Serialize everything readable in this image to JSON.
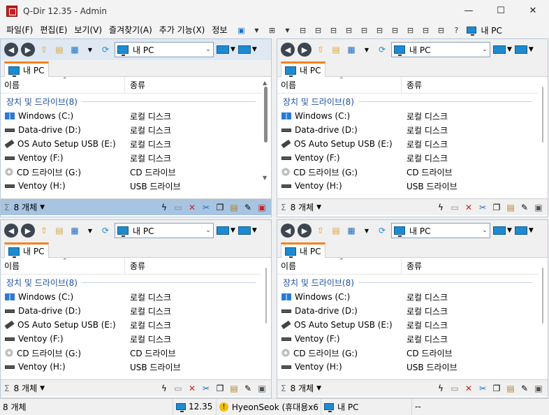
{
  "window": {
    "title": "Q-Dir 12.35 - Admin",
    "minimize": "—",
    "maximize": "☐",
    "close": "✕"
  },
  "menu": [
    "파일(F)",
    "편집(E)",
    "보기(V)",
    "즐겨찾기(A)",
    "추가 기능(X)",
    "정보"
  ],
  "menu_right_label": "내 PC",
  "panes": [
    {
      "address": "내 PC",
      "tab": "내 PC",
      "columns": {
        "name": "이름",
        "type": "종류"
      },
      "group": "장치 및 드라이브(8)",
      "rows": [
        {
          "name": "Windows (C:)",
          "type": "로컬 디스크",
          "icon": "windows-drive-icon"
        },
        {
          "name": "Data-drive (D:)",
          "type": "로컬 디스크",
          "icon": "hard-drive-icon"
        },
        {
          "name": "OS Auto Setup USB (E:)",
          "type": "로컬 디스크",
          "icon": "usb-drive-icon"
        },
        {
          "name": "Ventoy (F:)",
          "type": "로컬 디스크",
          "icon": "hard-drive-icon"
        },
        {
          "name": "CD 드라이브 (G:)",
          "type": "CD 드라이브",
          "icon": "cd-drive-icon"
        },
        {
          "name": "Ventoy (H:)",
          "type": "USB 드라이브",
          "icon": "hard-drive-icon"
        }
      ],
      "status_count": "8 개체"
    },
    {
      "address": "내 PC",
      "tab": "내 PC",
      "columns": {
        "name": "이름",
        "type": "종류"
      },
      "group": "장치 및 드라이브(8)",
      "rows": [
        {
          "name": "Windows (C:)",
          "type": "로컬 디스크",
          "icon": "windows-drive-icon"
        },
        {
          "name": "Data-drive (D:)",
          "type": "로컬 디스크",
          "icon": "hard-drive-icon"
        },
        {
          "name": "OS Auto Setup USB (E:)",
          "type": "로컬 디스크",
          "icon": "usb-drive-icon"
        },
        {
          "name": "Ventoy (F:)",
          "type": "로컬 디스크",
          "icon": "hard-drive-icon"
        },
        {
          "name": "CD 드라이브 (G:)",
          "type": "CD 드라이브",
          "icon": "cd-drive-icon"
        },
        {
          "name": "Ventoy (H:)",
          "type": "USB 드라이브",
          "icon": "hard-drive-icon"
        }
      ],
      "status_count": "8 개체"
    },
    {
      "address": "내 PC",
      "tab": "내 PC",
      "columns": {
        "name": "이름",
        "type": "종류"
      },
      "group": "장치 및 드라이브(8)",
      "rows": [
        {
          "name": "Windows (C:)",
          "type": "로컬 디스크",
          "icon": "windows-drive-icon"
        },
        {
          "name": "Data-drive (D:)",
          "type": "로컬 디스크",
          "icon": "hard-drive-icon"
        },
        {
          "name": "OS Auto Setup USB (E:)",
          "type": "로컬 디스크",
          "icon": "usb-drive-icon"
        },
        {
          "name": "Ventoy (F:)",
          "type": "로컬 디스크",
          "icon": "hard-drive-icon"
        },
        {
          "name": "CD 드라이브 (G:)",
          "type": "CD 드라이브",
          "icon": "cd-drive-icon"
        },
        {
          "name": "Ventoy (H:)",
          "type": "USB 드라이브",
          "icon": "hard-drive-icon"
        }
      ],
      "status_count": "8 개체"
    },
    {
      "address": "내 PC",
      "tab": "내 PC",
      "columns": {
        "name": "이름",
        "type": "종류"
      },
      "group": "장치 및 드라이브(8)",
      "rows": [
        {
          "name": "Windows (C:)",
          "type": "로컬 디스크",
          "icon": "windows-drive-icon"
        },
        {
          "name": "Data-drive (D:)",
          "type": "로컬 디스크",
          "icon": "hard-drive-icon"
        },
        {
          "name": "OS Auto Setup USB (E:)",
          "type": "로컬 디스크",
          "icon": "usb-drive-icon"
        },
        {
          "name": "Ventoy (F:)",
          "type": "로컬 디스크",
          "icon": "hard-drive-icon"
        },
        {
          "name": "CD 드라이브 (G:)",
          "type": "CD 드라이브",
          "icon": "cd-drive-icon"
        },
        {
          "name": "Ventoy (H:)",
          "type": "USB 드라이브",
          "icon": "hard-drive-icon"
        }
      ],
      "status_count": "8 개체"
    }
  ],
  "bottom_status": {
    "count": "8 개체",
    "version": "12.35",
    "user": "HyeonSeok (휴대용x6",
    "location": "내 PC",
    "extra": "--"
  },
  "colors": {
    "active_pane_status": "#a7c4e0",
    "tab_accent": "#f58220",
    "group_text": "#1e50a0"
  }
}
